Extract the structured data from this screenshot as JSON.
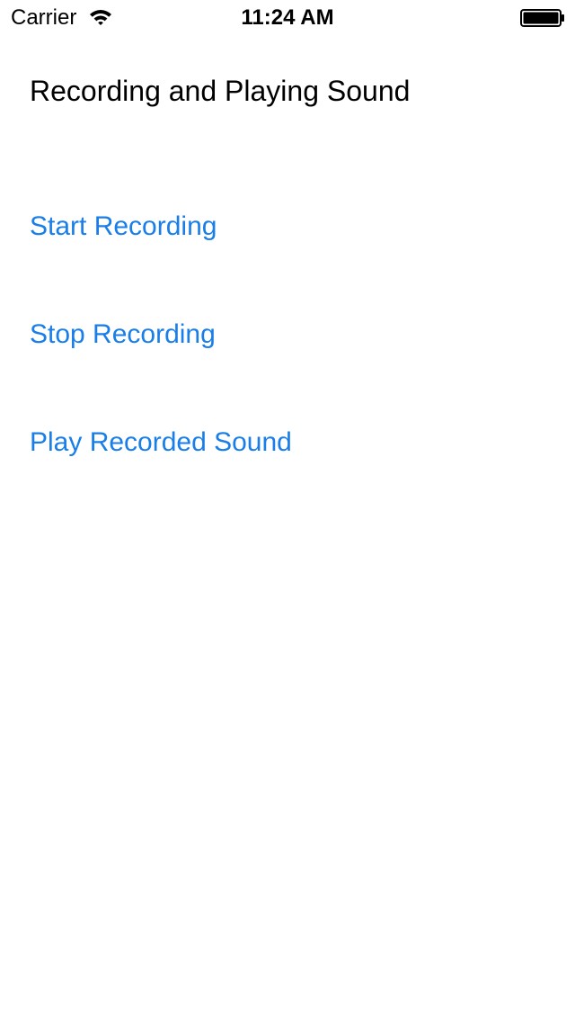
{
  "status_bar": {
    "carrier": "Carrier",
    "time": "11:24 AM",
    "wifi_icon": "wifi-icon",
    "battery_icon": "battery-icon"
  },
  "main": {
    "title": "Recording and Playing Sound",
    "buttons": {
      "start_label": "Start Recording",
      "stop_label": "Stop Recording",
      "play_label": "Play Recorded Sound"
    }
  },
  "colors": {
    "accent": "#1a7ee8",
    "text": "#000000",
    "background": "#ffffff"
  }
}
